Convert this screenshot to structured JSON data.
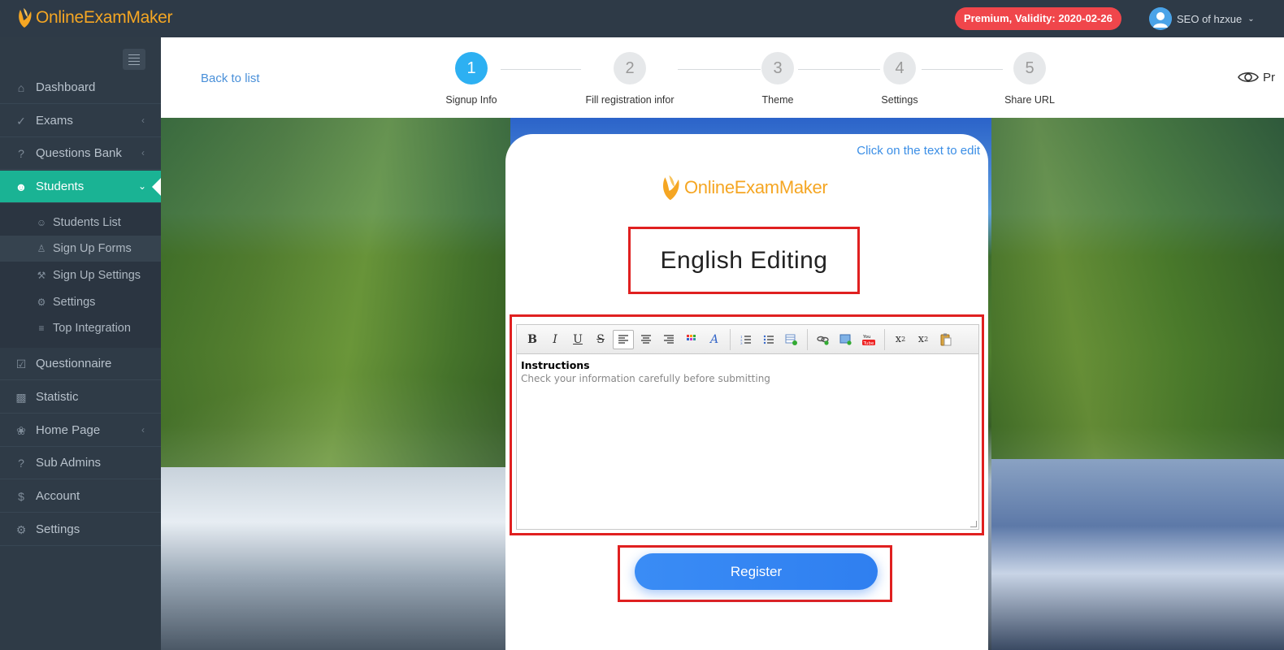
{
  "app": {
    "logo_text": "OnlineExamMaker",
    "premium_badge": "Premium, Validity: 2020-02-26",
    "user_name": "SEO of hzxue"
  },
  "sidebar": {
    "items": [
      {
        "label": "Dashboard",
        "icon": "home-icon"
      },
      {
        "label": "Exams",
        "icon": "check-circle-icon"
      },
      {
        "label": "Questions Bank",
        "icon": "question-circle-icon"
      },
      {
        "label": "Students",
        "icon": "users-icon"
      },
      {
        "label": "Questionnaire",
        "icon": "checkbox-icon"
      },
      {
        "label": "Statistic",
        "icon": "bar-chart-icon"
      },
      {
        "label": "Home Page",
        "icon": "leaf-icon"
      },
      {
        "label": "Sub Admins",
        "icon": "question-circle-icon"
      },
      {
        "label": "Account",
        "icon": "dollar-icon"
      },
      {
        "label": "Settings",
        "icon": "gear-icon"
      }
    ],
    "students_sub": [
      {
        "label": "Students List",
        "icon": "user-icon"
      },
      {
        "label": "Sign Up Forms",
        "icon": "user-plus-icon"
      },
      {
        "label": "Sign Up Settings",
        "icon": "wrench-icon"
      },
      {
        "label": "Settings",
        "icon": "gear-icon"
      },
      {
        "label": "Top Integration",
        "icon": "list-icon"
      }
    ]
  },
  "header": {
    "back_label": "Back to list",
    "preview_label": "Pr",
    "steps": [
      {
        "number": "1",
        "label": "Signup Info"
      },
      {
        "number": "2",
        "label": "Fill registration infor"
      },
      {
        "number": "3",
        "label": "Theme"
      },
      {
        "number": "4",
        "label": "Settings"
      },
      {
        "number": "5",
        "label": "Share URL"
      }
    ]
  },
  "form": {
    "edit_hint": "Click on the text to edit",
    "logo_text": "OnlineExamMaker",
    "title": "English Editing",
    "editor": {
      "heading": "Instructions",
      "text": "Check your information carefully before submitting"
    },
    "register_label": "Register"
  },
  "colors": {
    "sidebar_bg": "#2f3b47",
    "active_accent": "#1ab394",
    "step_active": "#2db0f2",
    "premium_badge": "#f0464b",
    "highlight_border": "#e02020",
    "register_button": "#3a8cf5",
    "logo_orange": "#f5a623"
  }
}
